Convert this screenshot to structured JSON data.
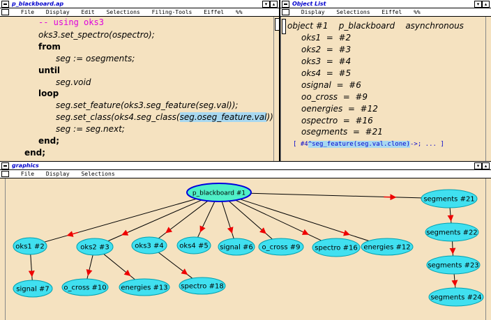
{
  "editor": {
    "title": "p_blackboard.ap",
    "menu": [
      "File",
      "Display",
      "Edit",
      "Selections",
      "Filing-Tools",
      "Eiffel",
      "%%"
    ],
    "lines": [
      {
        "text": "-- using oks3",
        "indent": 55,
        "style": "comment"
      },
      {
        "text": "oks3.set_spectro(ospectro);",
        "indent": 55,
        "style": "code"
      },
      {
        "text": "from",
        "indent": 55,
        "style": "kw"
      },
      {
        "text": "seg := osegments;",
        "indent": 80,
        "style": "code"
      },
      {
        "text": "until",
        "indent": 55,
        "style": "kw"
      },
      {
        "text": "seg.void",
        "indent": 80,
        "style": "code"
      },
      {
        "text": "loop",
        "indent": 55,
        "style": "kw"
      },
      {
        "text": "seg.set_feature(oks3.seg_feature(seg.val));",
        "indent": 80,
        "style": "code"
      },
      {
        "text": "end;",
        "indent": 55,
        "style": "kw"
      },
      {
        "text": "end;",
        "indent": 35,
        "style": "kw"
      }
    ],
    "class_line": {
      "prefix": "seg.set_class(oks4.seg_class(",
      "selected": "seg.oseg_feature.val",
      "suffix": "));"
    },
    "next_line": "seg := seg.next;"
  },
  "object_list": {
    "title": "Object List",
    "menu": [
      "Display",
      "Selections",
      "Eiffel",
      "%%"
    ],
    "header": "object #1    p_blackboard    asynchronous",
    "fields": [
      "oks1  =  #2",
      "oks2  =  #3",
      "oks3  =  #4",
      "oks4  =  #5",
      "osignal  =  #6",
      "oo_cross  =  #9",
      "oenergies  =  #12",
      "ospectro  =  #16",
      "osegments  =  #21"
    ],
    "query": {
      "prefix": "[ #4",
      "selected": "^seg_feature(seg.val.clone)",
      "suffix": "->; ... ]"
    }
  },
  "graphics": {
    "title": "graphics",
    "menu": [
      "File",
      "Display",
      "Selections"
    ],
    "root_label": "p_blackboard #1",
    "nodes": [
      {
        "id": "oks1",
        "label": "oks1 #2"
      },
      {
        "id": "oks2",
        "label": "oks2 #3"
      },
      {
        "id": "oks3",
        "label": "oks3 #4"
      },
      {
        "id": "oks4",
        "label": "oks4 #5"
      },
      {
        "id": "signal6",
        "label": "signal #6"
      },
      {
        "id": "ocross9",
        "label": "o_cross #9"
      },
      {
        "id": "spectro16",
        "label": "spectro #16"
      },
      {
        "id": "energies12",
        "label": "energies #12"
      },
      {
        "id": "signal7",
        "label": "signal #7"
      },
      {
        "id": "ocross10",
        "label": "o_cross #10"
      },
      {
        "id": "energies13",
        "label": "energies #13"
      },
      {
        "id": "spectro18",
        "label": "spectro #18"
      },
      {
        "id": "seg21",
        "label": "segments #21"
      },
      {
        "id": "seg22",
        "label": "segments #22"
      },
      {
        "id": "seg23",
        "label": "segments #23"
      },
      {
        "id": "seg24",
        "label": "segments #24"
      }
    ]
  },
  "colors": {
    "node_fill": "#40e0f0",
    "node_stroke": "#00a0b0",
    "root_fill": "#50f0c8",
    "root_stroke": "#0000dd",
    "arrow": "#ee0000",
    "background": "#f5e2c0"
  }
}
